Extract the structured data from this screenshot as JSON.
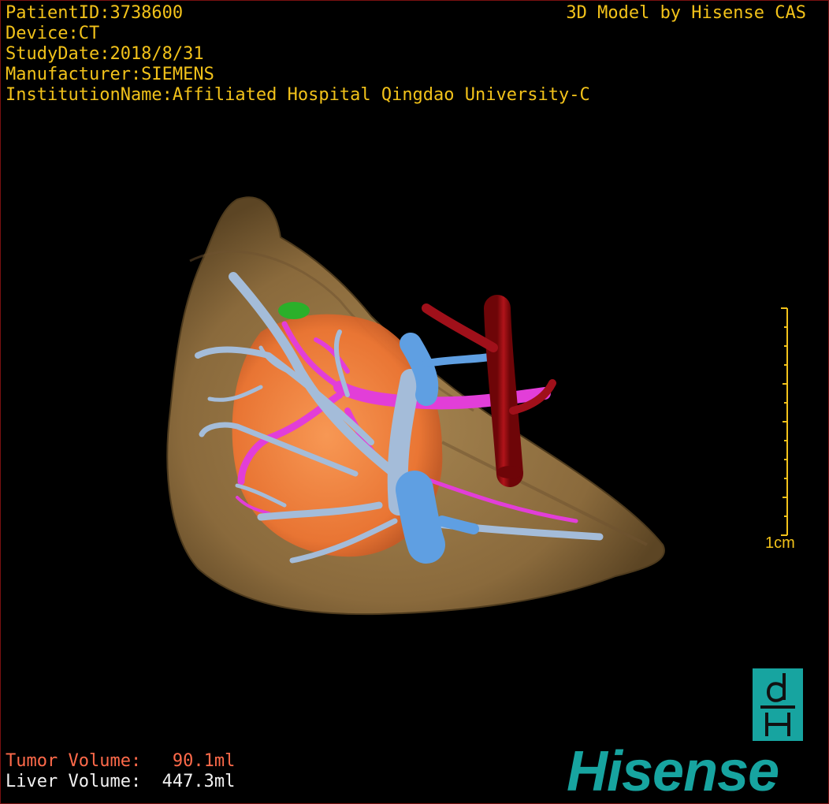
{
  "header": {
    "patient_id": "PatientID:3738600",
    "device": "Device:CT",
    "study_date": "StudyDate:2018/8/31",
    "manufacturer": "Manufacturer:SIEMENS",
    "institution": "InstitutionName:Affiliated Hospital Qingdao University-C"
  },
  "watermark": {
    "title": "3D Model by Hisense CAS"
  },
  "scale_bar": {
    "label": "1cm"
  },
  "volumes": {
    "tumor": "Tumor Volume:   90.1ml",
    "liver": "Liver Volume:  447.3ml"
  },
  "logo": {
    "wordmark": "Hisense",
    "mark_letters": "dH"
  },
  "colors": {
    "text": "#f2c21a",
    "tumor_text": "#ff6a4a",
    "liver": "#8a6a3c",
    "tumor": "#ff7a3a",
    "portal_vein": "#9fb8d8",
    "hepatic_artery": "#e23ed8",
    "vena_cava": "#9b0a10",
    "hepatic_vein": "#5a9be0",
    "lesion": "#2ab02a",
    "brand": "#17a4a0"
  }
}
